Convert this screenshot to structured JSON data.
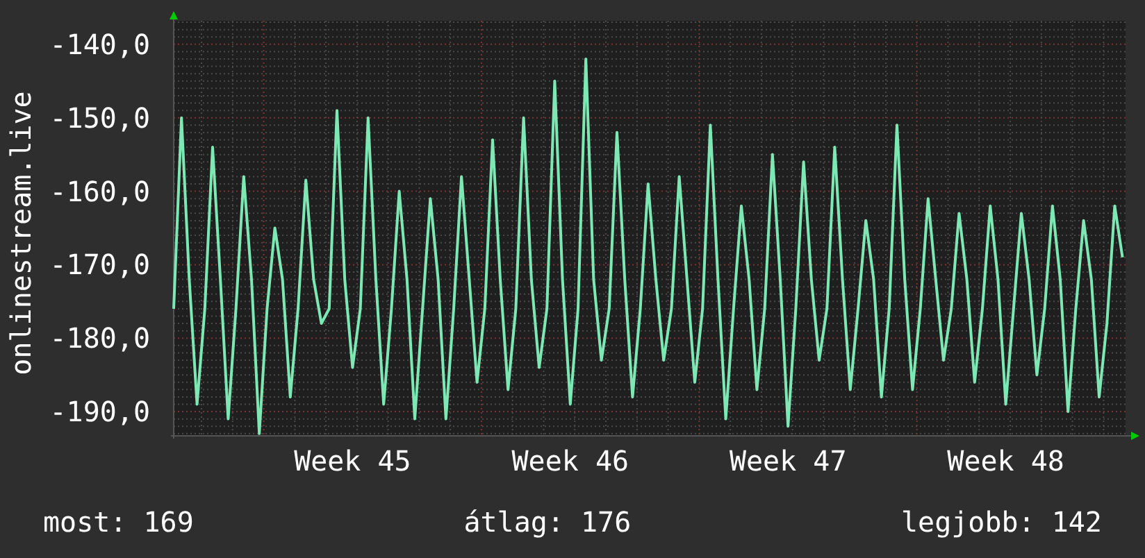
{
  "chart": {
    "chart_data": {
      "type": "line",
      "ylabel": "onlinestream.live",
      "categories": [
        null,
        null,
        null,
        null,
        null,
        null,
        null,
        null,
        null,
        null,
        null,
        null,
        null,
        null,
        null,
        null,
        null,
        null,
        null,
        null,
        null,
        null,
        null,
        "Week 45",
        null,
        null,
        null,
        null,
        null,
        null,
        null,
        null,
        null,
        null,
        null,
        null,
        null,
        null,
        null,
        null,
        null,
        null,
        null,
        null,
        null,
        null,
        null,
        null,
        null,
        null,
        null,
        "Week 46",
        null,
        null,
        null,
        null,
        null,
        null,
        null,
        null,
        null,
        null,
        null,
        null,
        null,
        null,
        null,
        null,
        null,
        null,
        null,
        null,
        null,
        null,
        null,
        null,
        null,
        null,
        null,
        "Week 47",
        null,
        null,
        null,
        null,
        null,
        null,
        null,
        null,
        null,
        null,
        null,
        null,
        null,
        null,
        null,
        null,
        null,
        null,
        null,
        null,
        null,
        null,
        null,
        null,
        null,
        null,
        null,
        "Week 48",
        null,
        null,
        null,
        null,
        null,
        null,
        null,
        null,
        null,
        null,
        null,
        null,
        null,
        null,
        null
      ],
      "series": [
        {
          "color": "#7ee8b4",
          "values": [
            -176,
            -150,
            -172,
            -189,
            -176,
            -154,
            -172,
            -191,
            -176,
            -158,
            -172,
            -193,
            -176,
            -165,
            -172,
            -188,
            -176,
            -158.5,
            -172,
            -178,
            -176,
            -149,
            -172,
            -184,
            -176,
            -150,
            -172,
            -189,
            -176,
            -160,
            -172,
            -191,
            -176,
            -161,
            -172,
            -191,
            -176,
            -158,
            -172,
            -186,
            -176,
            -153,
            -172,
            -187,
            -176,
            -150,
            -172,
            -184,
            -176,
            -145,
            -172,
            -189,
            -176,
            -142,
            -172,
            -183,
            -176,
            -152,
            -172,
            -188,
            -176,
            -159,
            -172,
            -183,
            -176,
            -158,
            -172,
            -186,
            -176,
            -151,
            -172,
            -191,
            -176,
            -162,
            -172,
            -187,
            -176,
            -155,
            -172,
            -192,
            -176,
            -156,
            -172,
            -183,
            -176,
            -154,
            -172,
            -187,
            -176,
            -164,
            -172,
            -188,
            -176,
            -151,
            -172,
            -187,
            -176,
            -161,
            -172,
            -183,
            -176,
            -163,
            -172,
            -186,
            -176,
            -162,
            -172,
            -189,
            -176,
            -163,
            -172,
            -185,
            -176,
            -162,
            -172,
            -190,
            -176,
            -164,
            -172,
            -188,
            -178,
            -162,
            -169
          ]
        }
      ],
      "ylim": [
        -193.3,
        -136.8
      ],
      "grid": true,
      "yticks": [
        {
          "value": -140,
          "label": "-140,0"
        },
        {
          "value": -150,
          "label": "-150,0"
        },
        {
          "value": -160,
          "label": "-160,0"
        },
        {
          "value": -170,
          "label": "-170,0"
        },
        {
          "value": -180,
          "label": "-180,0"
        },
        {
          "value": -190,
          "label": "-190,0"
        }
      ]
    }
  },
  "stats": [
    {
      "text": "most: 169"
    },
    {
      "text": "átlag: 176"
    },
    {
      "text": "legjobb: 142"
    }
  ]
}
